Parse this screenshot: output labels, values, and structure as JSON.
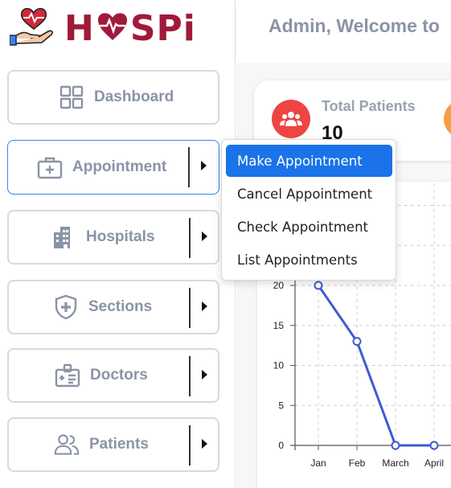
{
  "brand": {
    "name": "HOSPi"
  },
  "header": {
    "title": "Admin, Welcome to"
  },
  "sidebar": {
    "items": [
      {
        "label": "Dashboard",
        "icon": "grid-icon"
      },
      {
        "label": "Appointment",
        "icon": "medical-case-icon"
      },
      {
        "label": "Hospitals",
        "icon": "hospital-building-icon"
      },
      {
        "label": "Sections",
        "icon": "shield-plus-icon"
      },
      {
        "label": "Doctors",
        "icon": "doctor-badge-icon"
      },
      {
        "label": "Patients",
        "icon": "people-icon"
      }
    ]
  },
  "dropdown": {
    "items": [
      {
        "label": "Make Appointment"
      },
      {
        "label": "Cancel Appointment"
      },
      {
        "label": "Check Appointment"
      },
      {
        "label": "List Appointments"
      }
    ]
  },
  "stats": {
    "total_patients": {
      "label": "Total Patients",
      "value": "10"
    }
  },
  "colors": {
    "brand": "#a01a3a",
    "accent": "#1a73e8",
    "line": "#3f5bd0",
    "stat_red": "#ef4444",
    "stat_orange": "#f59e42"
  },
  "chart_data": {
    "type": "line",
    "categories": [
      "Jan",
      "Feb",
      "March",
      "April"
    ],
    "series": [
      {
        "values": [
          20,
          13,
          0,
          0
        ]
      }
    ],
    "yticks": [
      "0",
      "5",
      "10",
      "15",
      "20"
    ],
    "ylim": [
      0,
      20
    ],
    "grid": true
  }
}
